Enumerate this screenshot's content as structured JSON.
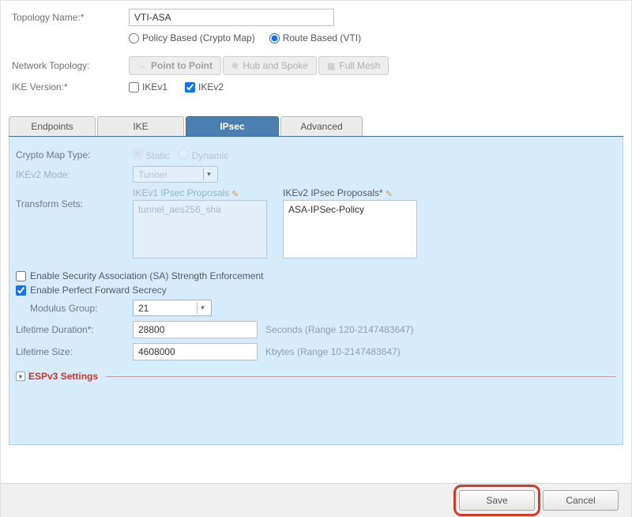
{
  "top": {
    "topologyNameLabel": "Topology Name:*",
    "topologyNameValue": "VTI-ASA",
    "policyBased": "Policy Based (Crypto Map)",
    "routeBased": "Route Based (VTI)",
    "networkTopologyLabel": "Network Topology:",
    "ptp": "Point to Point",
    "hub": "Hub and Spoke",
    "mesh": "Full Mesh",
    "ikeVersionLabel": "IKE Version:*",
    "ikev1": "IKEv1",
    "ikev2": "IKEv2"
  },
  "tabs": {
    "endpoints": "Endpoints",
    "ike": "IKE",
    "ipsec": "IPsec",
    "advanced": "Advanced"
  },
  "ipsec": {
    "cryptoMapTypeLabel": "Crypto Map Type:",
    "cryptoStatic": "Static",
    "cryptoDynamic": "Dynamic",
    "ikev2ModeLabel": "IKEv2 Mode:",
    "ikev2ModeValue": "Tunnel",
    "transformSetsLabel": "Transform Sets:",
    "ikev1ProposalsLabel": "IKEv1 IPsec Proposals",
    "ikev1ProposalsValue": "tunnel_aes256_sha",
    "ikev2ProposalsLabel": "IKEv2 IPsec Proposals*",
    "ikev2ProposalsValue": "ASA-IPSec-Policy",
    "saEnforce": "Enable Security Association (SA) Strength Enforcement",
    "pfs": "Enable Perfect Forward Secrecy",
    "modGroupLabel": "Modulus Group:",
    "modGroupValue": "21",
    "lifeDurLabel": "Lifetime Duration*:",
    "lifeDurValue": "28800",
    "lifeDurHint": "Seconds (Range 120-2147483647)",
    "lifeSizeLabel": "Lifetime Size:",
    "lifeSizeValue": "4608000",
    "lifeSizeHint": "Kbytes (Range 10-2147483647)",
    "espv3": "ESPv3 Settings"
  },
  "footer": {
    "save": "Save",
    "cancel": "Cancel"
  }
}
